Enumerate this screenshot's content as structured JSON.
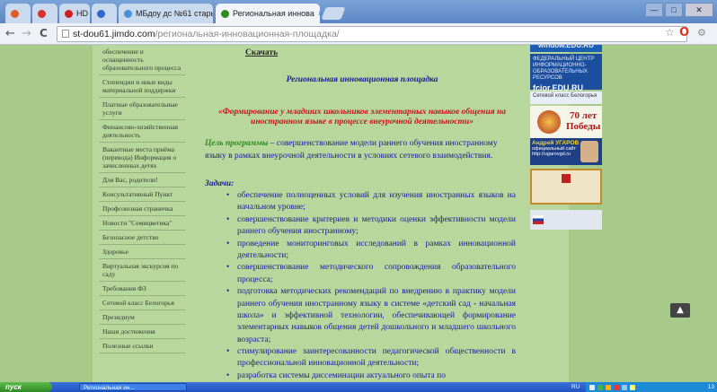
{
  "browser": {
    "tabs": [
      {
        "label": "",
        "color": "#e05a2a"
      },
      {
        "label": "",
        "color": "#d63030"
      },
      {
        "label": "HD",
        "color": "#cc2020"
      },
      {
        "label": "",
        "color": "#3366cc"
      },
      {
        "label": "МБдоу дс №61 старый",
        "color": "#4a90d9"
      },
      {
        "label": "Региональная иннова",
        "color": "#2f8a22"
      }
    ],
    "window_buttons": {
      "minimize": "—",
      "maximize": "□",
      "close": "✕"
    },
    "back": "←",
    "forward": "→",
    "reload": "C",
    "url_host": "st-dou61.jimdo.com",
    "url_path": "/региональная-инновационная-площадка/"
  },
  "sidebar": {
    "items": [
      "обеспечение и оснащенность образовательного процесса",
      "Стипендии и иные виды материальной поддержки",
      "Платные образовательные услуги",
      "Финансово-хозяйственная деятельность",
      "Вакантные места приёма (перевода) Информация о зачисленных детях",
      "Для Вас, родители!",
      "Консультативный Пункт",
      "Профсоюзная страничка",
      "Новости \"Семицветика\"",
      "Безопасное детство",
      "Здоровье",
      "Виртуальная экскурсия по саду",
      "Требования ФЗ",
      "Сетевой класс Белогорья",
      "Президиум",
      "Наши достижения",
      "Полезные ссылки"
    ]
  },
  "content": {
    "download_link": "Скачать",
    "platform_title": "Региональная инновационная площадка",
    "theme_title": "«Формирование у младших школьников элементарных навыков общения на иностранном языке в процессе внеурочной деятельности»",
    "goal_label": "Цель программы",
    "goal_text": " – совершенствование модели раннего обучения иностранному языку в рамках внеурочной деятельности в условиях сетевого взаимодействия.",
    "tasks_heading": "Задачи:",
    "tasks": [
      "обеспечение полноценных условий для изучения иностранных языков на начальном уровне;",
      "совершенствование критериев и методики оценки эффективности модели раннего обучения иностранному;",
      "проведение мониторинговых исследований в рамках инновационной деятельности;",
      "совершенствование методического сопровождения образовательного процесса;",
      "подготовка методических рекомендаций по внедрению в практику модели раннего обучения иностранному языку в системе «детский сад - начальная школа» и эффективной технологии, обеспечивающей формирование элементарных навыков общения детей дошкольного и младшего школьного возраста;",
      "стимулирование заинтересованности педагогической общественности в профессиональной инновационной деятельности;",
      "разработка системы диссеминации актуального опыта по"
    ]
  },
  "widgets": {
    "window_edu": "window.EDU.RU",
    "fcior_small": "ФЕДЕРАЛЬНЫЙ ЦЕНТР ИНФОРМАЦИОННО-ОБРАЗОВАТЕЛЬНЫХ РЕСУРСОВ",
    "fcior": "fcior.EDU.RU",
    "network_class": "Сетевой класс Белогорья",
    "victory_line1": "70 лет",
    "victory_line2": "Победы",
    "governor_name": "Андрей УГАРОВ",
    "governor_sub": "официальный сайт",
    "governor_url": "http://ugarovgd.ru",
    "scroll_top": "▲"
  },
  "taskbar": {
    "start_label": "пуск",
    "task_label": "Региональная ин...",
    "lang": "RU",
    "clock": "13"
  }
}
